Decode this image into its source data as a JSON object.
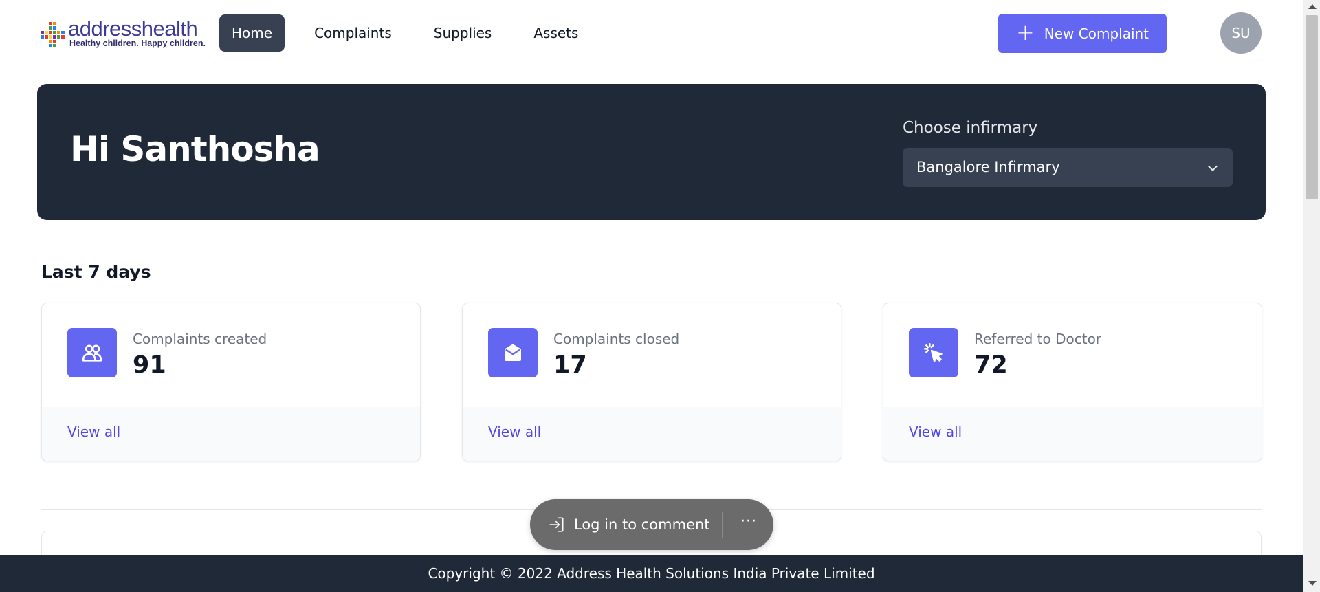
{
  "brand": {
    "name": "addresshealth",
    "tagline": "Healthy children. Happy children.",
    "colors": {
      "accent": "#6366f1",
      "dark": "#1f2937",
      "link": "#4f46e5"
    }
  },
  "nav": {
    "items": [
      {
        "label": "Home",
        "active": true
      },
      {
        "label": "Complaints",
        "active": false
      },
      {
        "label": "Supplies",
        "active": false
      },
      {
        "label": "Assets",
        "active": false
      }
    ],
    "new_button_label": "New Complaint",
    "avatar_initials": "SU"
  },
  "hero": {
    "greeting": "Hi Santhosha",
    "infirmary_label": "Choose infirmary",
    "infirmary_selected": "Bangalore Infirmary"
  },
  "stats": {
    "title": "Last 7 days",
    "cards": [
      {
        "label": "Complaints created",
        "value": "91",
        "link": "View all",
        "icon": "users-icon"
      },
      {
        "label": "Complaints closed",
        "value": "17",
        "link": "View all",
        "icon": "envelope-open-icon"
      },
      {
        "label": "Referred to Doctor",
        "value": "72",
        "link": "View all",
        "icon": "cursor-click-icon"
      }
    ]
  },
  "footer": {
    "copyright": "Copyright © 2022 Address Health Solutions India Private Limited"
  },
  "comment_pill": {
    "login_label": "Log in to comment",
    "more_label": "···"
  }
}
